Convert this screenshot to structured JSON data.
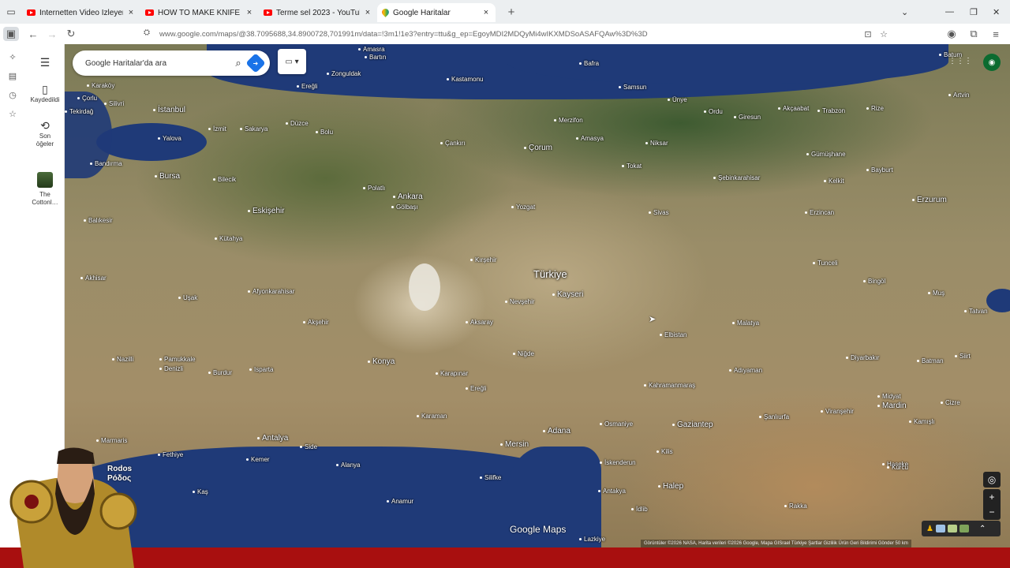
{
  "browser": {
    "tabs": [
      {
        "title": "Internetten Video İzleyerek Yer…",
        "active": false
      },
      {
        "title": "HOW TO MAKE KNIFE FROM SP…",
        "active": false
      },
      {
        "title": "Terme sel 2023 - YouTube",
        "active": false
      },
      {
        "title": "Google Haritalar",
        "active": true
      }
    ],
    "new_tab": "+",
    "close_glyph": "×",
    "url": "www.google.com/maps/@38.7095688,34.8900728,701991m/data=!3m1!1e3?entry=ttu&g_ep=EgoyMDI2MDQyMi4wIKXMDSoASAFQAw%3D%3D",
    "window_controls": {
      "dropdown": "⌄",
      "minimize": "—",
      "restore": "❐",
      "close": "✕"
    }
  },
  "maps": {
    "rail": {
      "menu_glyph": "☰",
      "saved_label": "Kaydedildi",
      "recent_label_1": "Son",
      "recent_label_2": "öğeler",
      "thumb_label": "The Cottonl…"
    },
    "search": {
      "placeholder": "Google Haritalar'da ara"
    },
    "branding": "Google Maps",
    "attribution": "Görüntüler ©2026 NASA, Harita verileri ©2026 Google, Mapa GISrael   Türkiye   Şartlar   Gizlilik   Ürün Geri Bildirimi Gönder   50 km",
    "country_label": "Türkiye",
    "cities": [
      {
        "name": "Amasra"
      },
      {
        "name": "Bartın"
      },
      {
        "name": "Zonguldak"
      },
      {
        "name": "Kastamonu"
      },
      {
        "name": "Bafra"
      },
      {
        "name": "Samsun"
      },
      {
        "name": "Ünye"
      },
      {
        "name": "Ordu"
      },
      {
        "name": "Giresun"
      },
      {
        "name": "Akçaabat"
      },
      {
        "name": "Trabzon"
      },
      {
        "name": "Rize"
      },
      {
        "name": "Batum"
      },
      {
        "name": "Artvin"
      },
      {
        "name": "Karaköy"
      },
      {
        "name": "Çorlu"
      },
      {
        "name": "Silivri"
      },
      {
        "name": "Tekirdağ"
      },
      {
        "name": "İstanbul"
      },
      {
        "name": "Ereğli"
      },
      {
        "name": "İzmit"
      },
      {
        "name": "Sakarya"
      },
      {
        "name": "Düzce"
      },
      {
        "name": "Bolu"
      },
      {
        "name": "Merzifon"
      },
      {
        "name": "Amasya"
      },
      {
        "name": "Niksar"
      },
      {
        "name": "Gümüşhane"
      },
      {
        "name": "Yalova"
      },
      {
        "name": "Çankırı"
      },
      {
        "name": "Çorum"
      },
      {
        "name": "Tokat"
      },
      {
        "name": "Bayburt"
      },
      {
        "name": "Bandırma"
      },
      {
        "name": "Bursa"
      },
      {
        "name": "Bilecik"
      },
      {
        "name": "Polatlı"
      },
      {
        "name": "Ankara"
      },
      {
        "name": "Gölbaşı"
      },
      {
        "name": "Yozgat"
      },
      {
        "name": "Şebinkarahisar"
      },
      {
        "name": "Kelkit"
      },
      {
        "name": "Erzurum"
      },
      {
        "name": "Eskişehir"
      },
      {
        "name": "Sivas"
      },
      {
        "name": "Erzincan"
      },
      {
        "name": "Balıkesir"
      },
      {
        "name": "Kütahya"
      },
      {
        "name": "Kırşehir"
      },
      {
        "name": "Tunceli"
      },
      {
        "name": "Akhisar"
      },
      {
        "name": "Kayseri"
      },
      {
        "name": "Bingöl"
      },
      {
        "name": "Muş"
      },
      {
        "name": "Afyonkarahisar"
      },
      {
        "name": "Nevşehir"
      },
      {
        "name": "Uşak"
      },
      {
        "name": "Akşehir"
      },
      {
        "name": "Aksaray"
      },
      {
        "name": "Elbistan"
      },
      {
        "name": "Malatya"
      },
      {
        "name": "Tatvan"
      },
      {
        "name": "Nazilli"
      },
      {
        "name": "Pamukkale"
      },
      {
        "name": "Denizli"
      },
      {
        "name": "Isparta"
      },
      {
        "name": "Konya"
      },
      {
        "name": "Niğde"
      },
      {
        "name": "Burdur"
      },
      {
        "name": "Karapınar"
      },
      {
        "name": "Diyarbakır"
      },
      {
        "name": "Batman"
      },
      {
        "name": "Siirt"
      },
      {
        "name": "Adıyaman"
      },
      {
        "name": "Kahramanmaraş"
      },
      {
        "name": "Ereğli"
      },
      {
        "name": "Karaman"
      },
      {
        "name": "Şanlıurfa"
      },
      {
        "name": "Viranşehir"
      },
      {
        "name": "Mardin"
      },
      {
        "name": "Midyat"
      },
      {
        "name": "Cizre"
      },
      {
        "name": "Marmaris"
      },
      {
        "name": "Fethiye"
      },
      {
        "name": "Antalya"
      },
      {
        "name": "Adana"
      },
      {
        "name": "Osmaniye"
      },
      {
        "name": "Gaziantep"
      },
      {
        "name": "Kemer"
      },
      {
        "name": "Side"
      },
      {
        "name": "Mersin"
      },
      {
        "name": "Kamışlı"
      },
      {
        "name": "Alanya"
      },
      {
        "name": "Kilis"
      },
      {
        "name": "Kaş"
      },
      {
        "name": "Silifke"
      },
      {
        "name": "İskenderun"
      },
      {
        "name": "Halep"
      },
      {
        "name": "Haseke"
      },
      {
        "name": "Anamur"
      },
      {
        "name": "Antakya"
      },
      {
        "name": "İdlib"
      },
      {
        "name": "Rakka"
      },
      {
        "name": "Lazkiye"
      },
      {
        "name": "Kurcu"
      }
    ],
    "controls": {
      "locate": "◎",
      "zoom_in": "+",
      "zoom_out": "−",
      "expand": "⌃"
    }
  },
  "overlay": {
    "avatar_name_1": "Rodos",
    "avatar_name_2": "Póδος"
  },
  "colors": {
    "bottom_band": "#a80f0f",
    "sea": "#1f3a78",
    "directions": "#1a73e8"
  }
}
